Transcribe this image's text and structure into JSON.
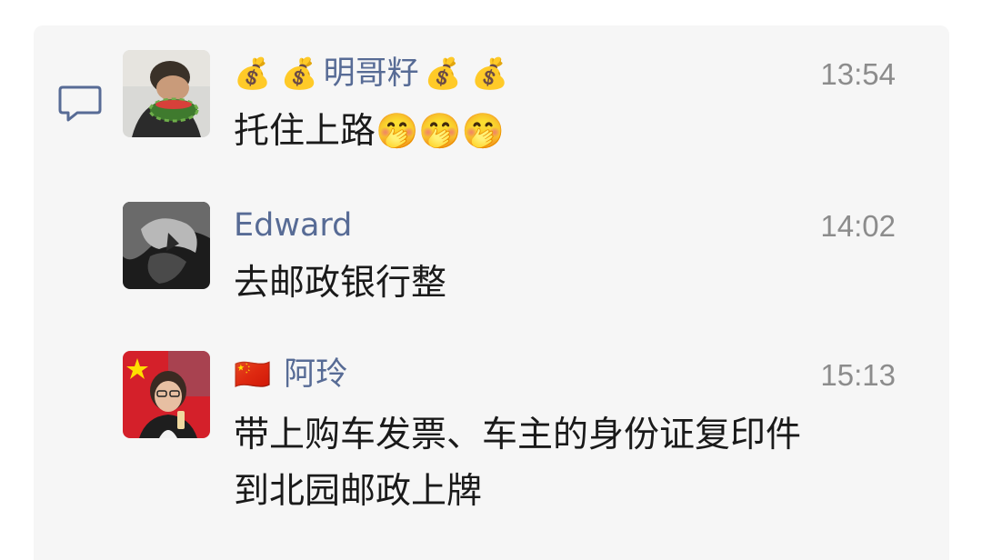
{
  "messages": [
    {
      "name_prefix_emoji": "💰 💰",
      "name": "明哥籽",
      "name_suffix_emoji": "💰 💰",
      "time": "13:54",
      "text": "托住上路",
      "text_emoji": "🤭🤭🤭",
      "avatar_icon": "watermelon-person-avatar"
    },
    {
      "name": "Edward",
      "time": "14:02",
      "text": "去邮政银行整",
      "avatar_icon": "dark-illustration-avatar"
    },
    {
      "name_prefix_emoji": "🇨🇳",
      "name": "阿玲",
      "time": "15:13",
      "text_line1": "带上购车发票、车主的身份证复印件",
      "text_line2": "到北园邮政上牌",
      "avatar_icon": "woman-with-flag-avatar"
    }
  ],
  "icons": {
    "comment": "comment-bubble-icon"
  },
  "colors": {
    "name": "#576b95",
    "time": "#8c8c8c",
    "text": "#1a1a1a",
    "panel_bg": "#f6f6f6"
  }
}
